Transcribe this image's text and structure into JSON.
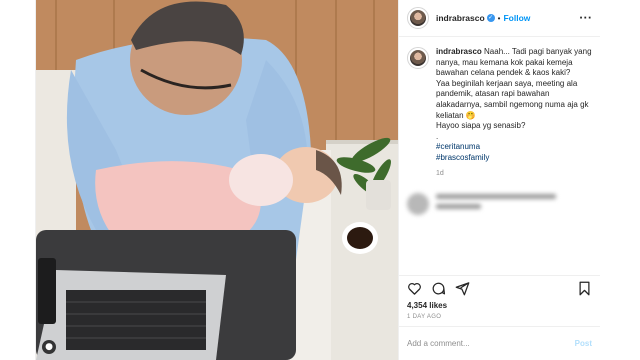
{
  "post": {
    "username": "indrabrasco",
    "follow_label": "Follow",
    "more_label": "···",
    "caption": {
      "username": "indrabrasco",
      "lines": [
        "Naah... Tadi pagi banyak yang nanya, mau kemana kok pakai kemeja bawahan celana pendek & kaos kaki?",
        "Yaa beginilah kerjaan saya, meeting ala pandemik, atasan rapi bawahan alakadarnya, sambil ngemong numa aja gk keliatan 🤭",
        "Hayoo siapa yg senasib?",
        "."
      ],
      "hashtags": [
        "#ceritanuma",
        "#brascosfamily"
      ],
      "time": "1d"
    },
    "likes": "4,354 likes",
    "date": "1 DAY AGO",
    "comment_placeholder": "Add a comment...",
    "post_label": "Post",
    "photo_corner_icon": "user-tag-icon"
  },
  "colors": {
    "link_blue": "#0095f6",
    "hashtag_blue": "#00376b",
    "post_disabled": "#b2dffc",
    "muted": "#8e8e8e"
  }
}
